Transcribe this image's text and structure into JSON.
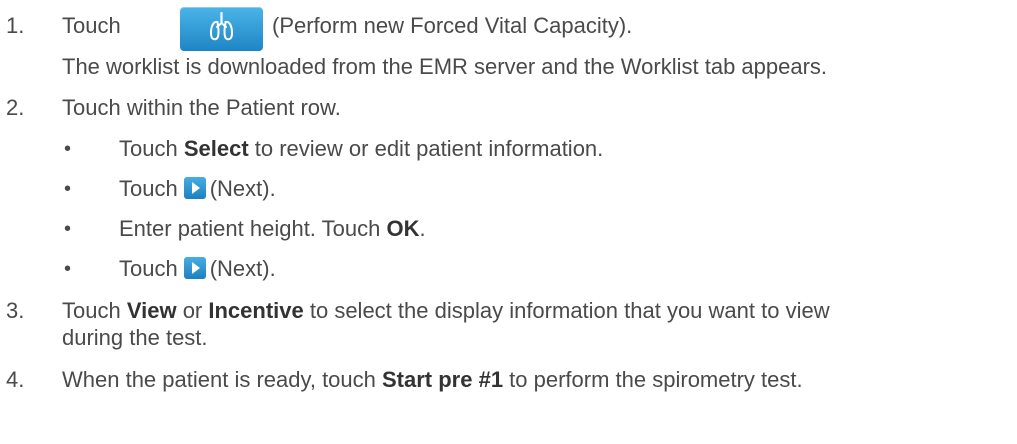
{
  "steps": [
    {
      "number": "1.",
      "pre": "Touch",
      "post": "(Perform new Forced Vital Capacity).",
      "note": "The worklist is downloaded from the EMR server and the Worklist tab appears."
    },
    {
      "number": "2.",
      "text": "Touch within the Patient row.",
      "bullets": [
        {
          "pre": "Touch ",
          "bold": "Select",
          "post": " to review or edit patient information."
        },
        {
          "pre": "Touch",
          "post": "(Next)."
        },
        {
          "pre": "Enter patient height. Touch ",
          "bold": "OK",
          "post": "."
        },
        {
          "pre": "Touch",
          "post": "(Next)."
        }
      ]
    },
    {
      "number": "3.",
      "pre": "Touch ",
      "bold1": "View",
      "mid": " or ",
      "bold2": "Incentive",
      "post": " to select the display information that you want to view",
      "line2": "during the test."
    },
    {
      "number": "4.",
      "pre": "When the patient is ready, touch ",
      "bold": "Start pre #1",
      "post": " to perform the spirometry test."
    }
  ],
  "bullet_symbol": "•",
  "icons": {
    "fvc": "lungs-icon",
    "next": "next-arrow-icon",
    "accent_color": "#2b97d6"
  }
}
